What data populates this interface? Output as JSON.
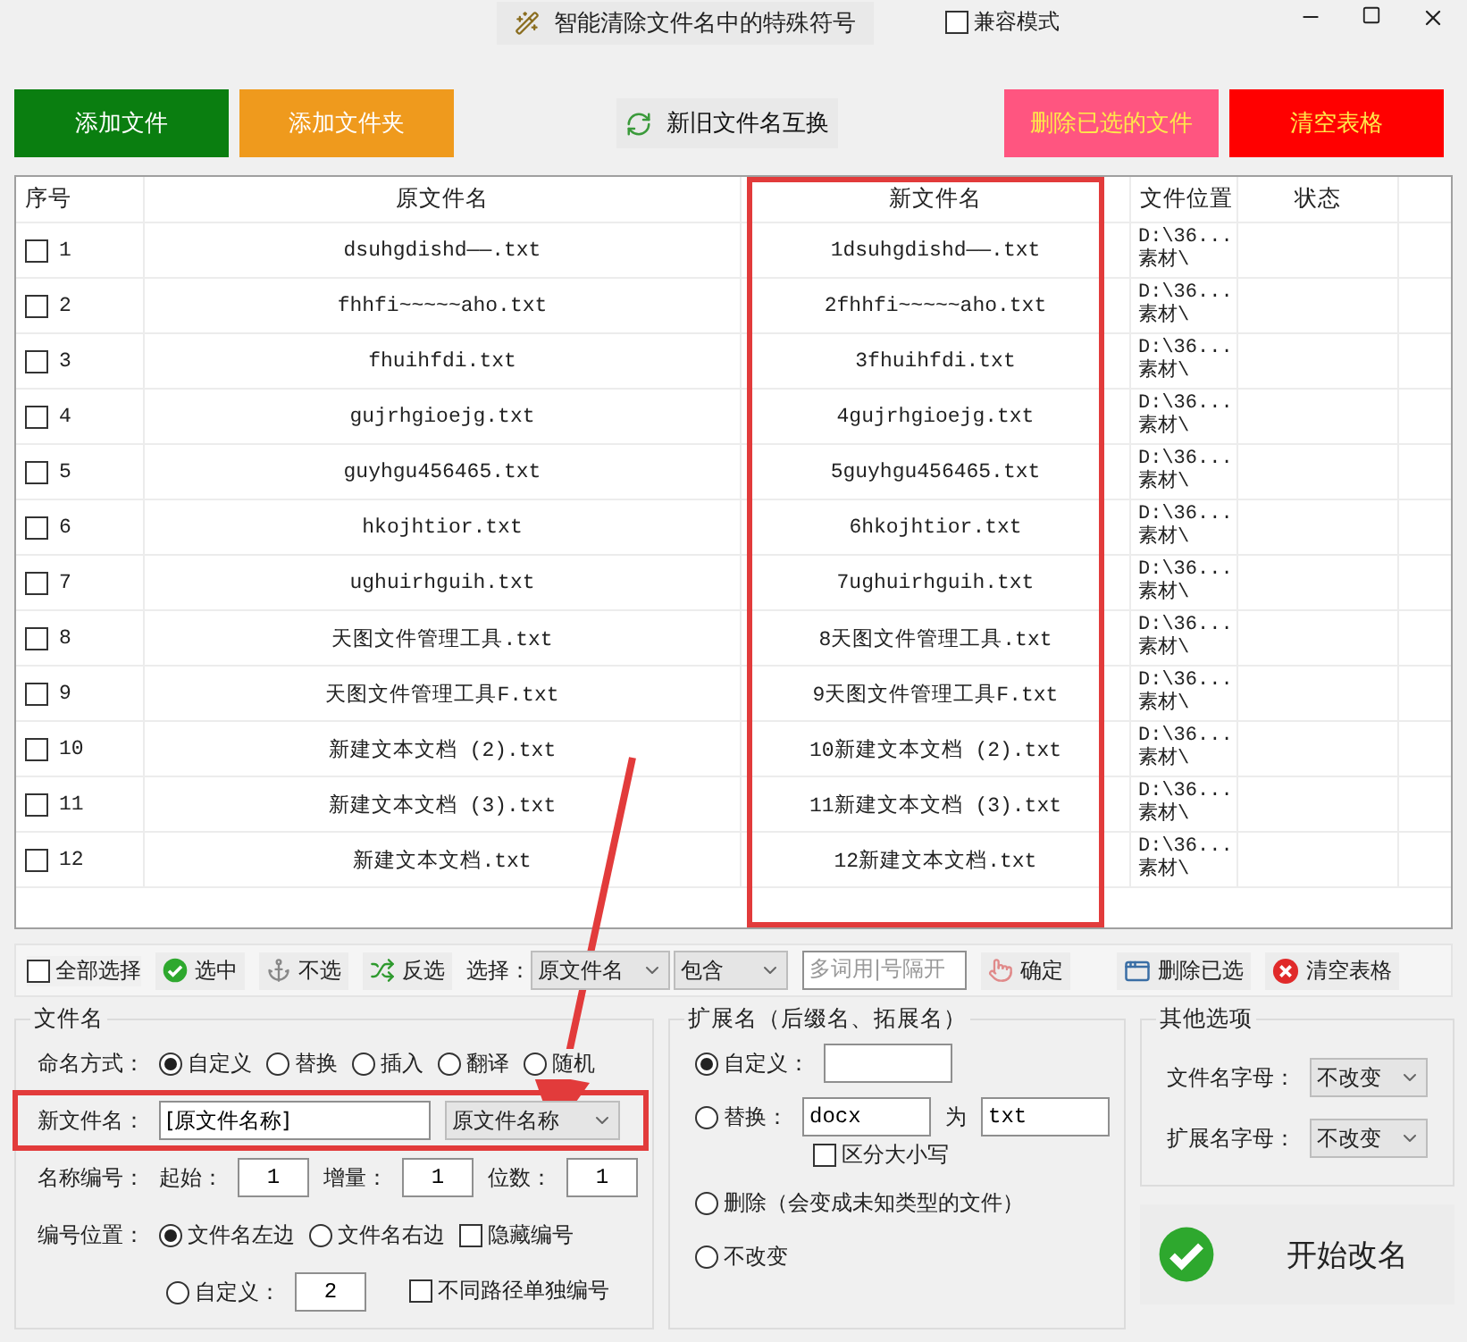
{
  "title_bar": {
    "title": "智能清除文件名中的特殊符号",
    "compat_mode": {
      "label": "兼容模式",
      "checked": false
    }
  },
  "top_buttons": [
    {
      "label": "添加文件",
      "kind": "green"
    },
    {
      "label": "添加文件夹",
      "kind": "orange"
    },
    {
      "label": "新旧文件名互换",
      "kind": "swap"
    },
    {
      "label": "删除已选的文件",
      "kind": "pink"
    },
    {
      "label": "清空表格",
      "kind": "red"
    }
  ],
  "table": {
    "columns": [
      "序号",
      "原文件名",
      "新文件名",
      "文件位置",
      "状态"
    ],
    "rows": [
      {
        "index": "1",
        "checked": false,
        "original": "dsuhgdishd——.txt",
        "renamed": "1dsuhgdishd——.txt",
        "location": "D:\\36...\n素材\\"
      },
      {
        "index": "2",
        "checked": false,
        "original": "fhhfi~~~~~aho.txt",
        "renamed": "2fhhfi~~~~~aho.txt",
        "location": "D:\\36...\n素材\\"
      },
      {
        "index": "3",
        "checked": false,
        "original": "fhuihfdi.txt",
        "renamed": "3fhuihfdi.txt",
        "location": "D:\\36...\n素材\\"
      },
      {
        "index": "4",
        "checked": false,
        "original": "gujrhgioejg.txt",
        "renamed": "4gujrhgioejg.txt",
        "location": "D:\\36...\n素材\\"
      },
      {
        "index": "5",
        "checked": false,
        "original": "guyhgu456465.txt",
        "renamed": "5guyhgu456465.txt",
        "location": "D:\\36...\n素材\\"
      },
      {
        "index": "6",
        "checked": false,
        "original": "hkojhtior.txt",
        "renamed": "6hkojhtior.txt",
        "location": "D:\\36...\n素材\\"
      },
      {
        "index": "7",
        "checked": false,
        "original": "ughuirhguih.txt",
        "renamed": "7ughuirhguih.txt",
        "location": "D:\\36...\n素材\\"
      },
      {
        "index": "8",
        "checked": false,
        "original": "天图文件管理工具.txt",
        "renamed": "8天图文件管理工具.txt",
        "location": "D:\\36...\n素材\\"
      },
      {
        "index": "9",
        "checked": false,
        "original": "天图文件管理工具F.txt",
        "renamed": "9天图文件管理工具F.txt",
        "location": "D:\\36...\n素材\\"
      },
      {
        "index": "10",
        "checked": false,
        "original": "新建文本文档 (2).txt",
        "renamed": "10新建文本文档 (2).txt",
        "location": "D:\\36...\n素材\\"
      },
      {
        "index": "11",
        "checked": false,
        "original": "新建文本文档 (3).txt",
        "renamed": "11新建文本文档 (3).txt",
        "location": "D:\\36...\n素材\\"
      },
      {
        "index": "12",
        "checked": false,
        "original": "新建文本文档.txt",
        "renamed": "12新建文本文档.txt",
        "location": "D:\\36...\n素材\\"
      }
    ]
  },
  "toolbar": {
    "select_all": {
      "label": "全部选择",
      "checked": false
    },
    "buttons": [
      {
        "label": "选中",
        "kind": "check"
      },
      {
        "label": "不选",
        "kind": "anchor"
      },
      {
        "label": "反选",
        "kind": "shuffle"
      }
    ],
    "select_label": "选择：",
    "field_select": "原文件名",
    "match_select": "包含",
    "keyword": {
      "placeholder": "多词用|号隔开"
    },
    "confirm": "确定",
    "delete_selected": "删除已选",
    "clear_table": "清空表格"
  },
  "filename_group": {
    "title": "文件名",
    "mode_label": "命名方式：",
    "modes": [
      {
        "label": "自定义",
        "selected": true
      },
      {
        "label": "替换",
        "selected": false
      },
      {
        "label": "插入",
        "selected": false
      },
      {
        "label": "翻译",
        "selected": false
      },
      {
        "label": "随机",
        "selected": false
      }
    ],
    "new_name_label": "新文件名：",
    "new_name_value": "[原文件名称]",
    "new_name_select": "原文件名称",
    "numbering_label": "名称编号：",
    "numbering": [
      {
        "label": "起始：",
        "value": "1"
      },
      {
        "label": "增量：",
        "value": "1"
      },
      {
        "label": "位数：",
        "value": "1"
      }
    ],
    "position_label": "编号位置：",
    "positions": [
      {
        "label": "文件名左边",
        "selected": true
      },
      {
        "label": "文件名右边",
        "selected": false
      },
      {
        "label": "自定义：",
        "selected": false,
        "value": "2"
      }
    ],
    "hide_number": {
      "label": "隐藏编号",
      "checked": false
    },
    "separate_paths": {
      "label": "不同路径单独编号",
      "checked": false
    }
  },
  "extension_group": {
    "title": "扩展名（后缀名、拓展名）",
    "custom": {
      "label": "自定义：",
      "selected": true
    },
    "replace": {
      "label": "替换：",
      "selected": false,
      "from": "docx",
      "to_label": "为",
      "to": "txt"
    },
    "case_sensitive": {
      "label": "区分大小写",
      "checked": false
    },
    "delete": {
      "label": "删除（会变成未知类型的文件）",
      "selected": false
    },
    "keep": {
      "label": "不改变",
      "selected": false
    }
  },
  "other_options": {
    "title": "其他选项",
    "fields": [
      {
        "label": "文件名字母：",
        "value": "不改变"
      },
      {
        "label": "扩展名字母：",
        "value": "不改变"
      }
    ]
  },
  "start_button": "开始改名"
}
